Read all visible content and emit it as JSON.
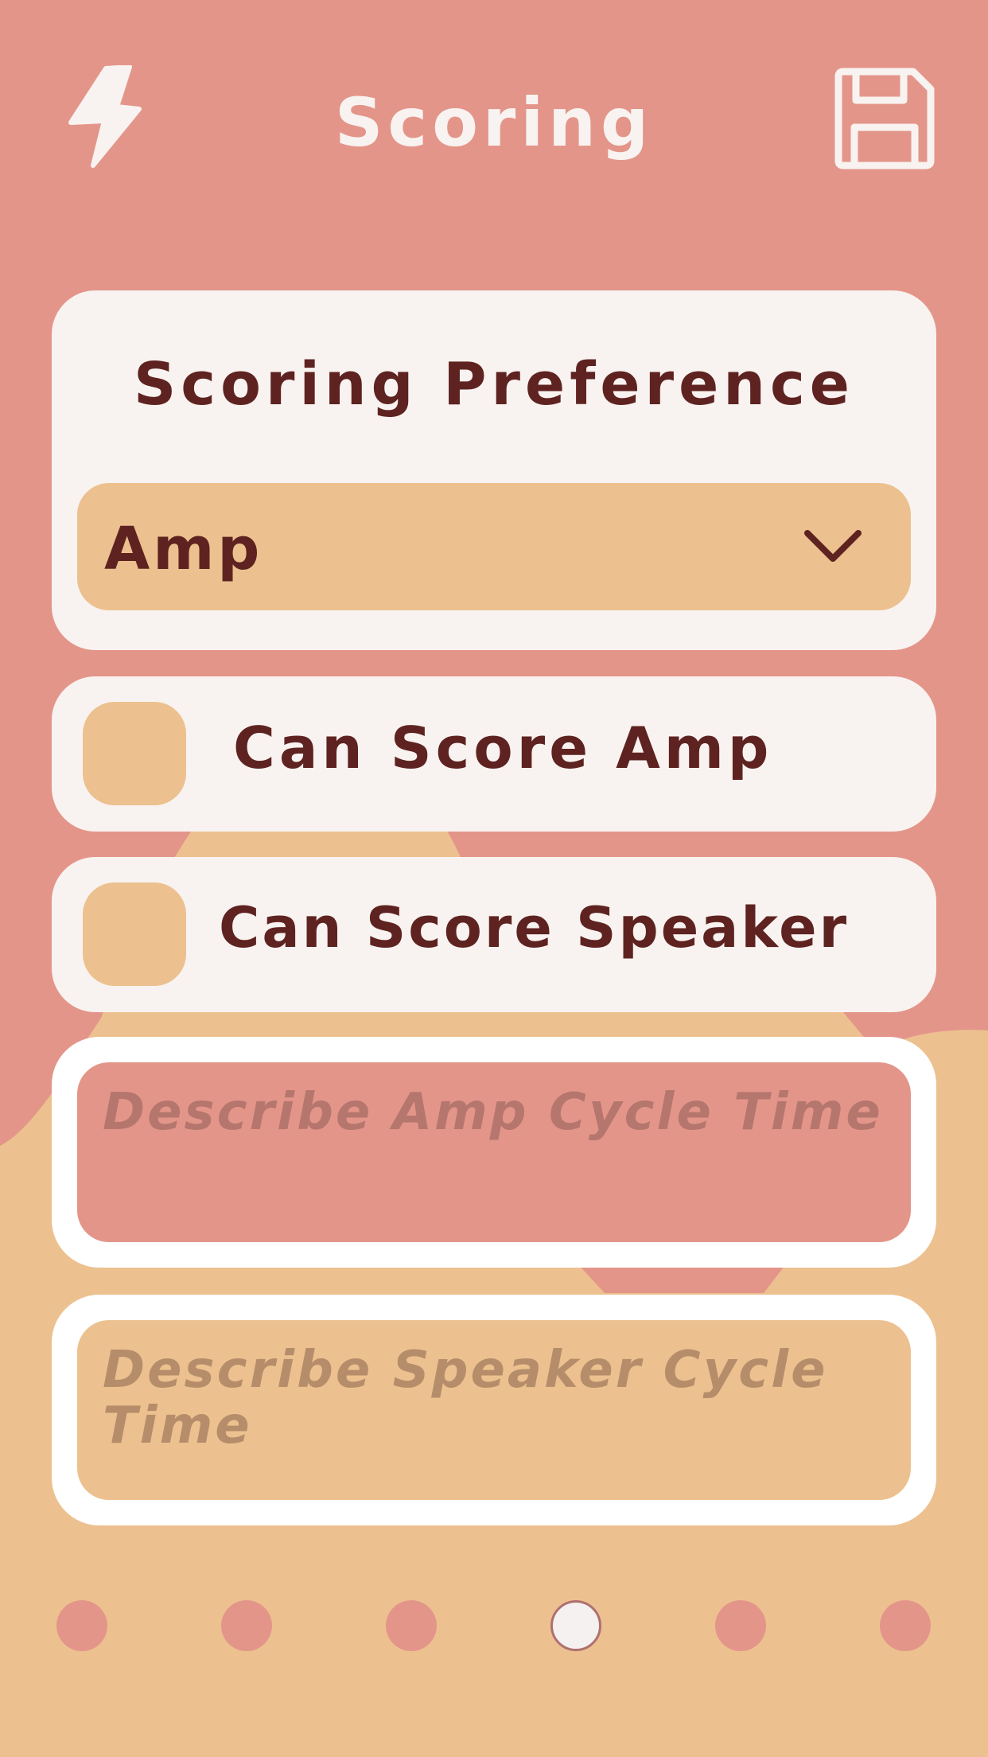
{
  "header": {
    "title": "Scoring",
    "left_icon": "lightning-bolt-icon",
    "right_icon": "save-floppy-icon"
  },
  "scoring_preference": {
    "title": "Scoring Preference",
    "selected": "Amp",
    "dropdown_icon": "chevron-down-icon"
  },
  "checkboxes": [
    {
      "label": "Can Score Amp",
      "checked": false
    },
    {
      "label": "Can Score Speaker",
      "checked": false
    }
  ],
  "text_inputs": [
    {
      "placeholder": "Describe Amp Cycle Time",
      "value": ""
    },
    {
      "placeholder": "Describe Speaker Cycle Time",
      "value": ""
    }
  ],
  "pagination": {
    "count": 6,
    "active_index": 3
  },
  "colors": {
    "background_pink": "#e4958a",
    "background_peach": "#ecc18f",
    "card": "#f8f3f0",
    "text_dark": "#5e2320"
  }
}
